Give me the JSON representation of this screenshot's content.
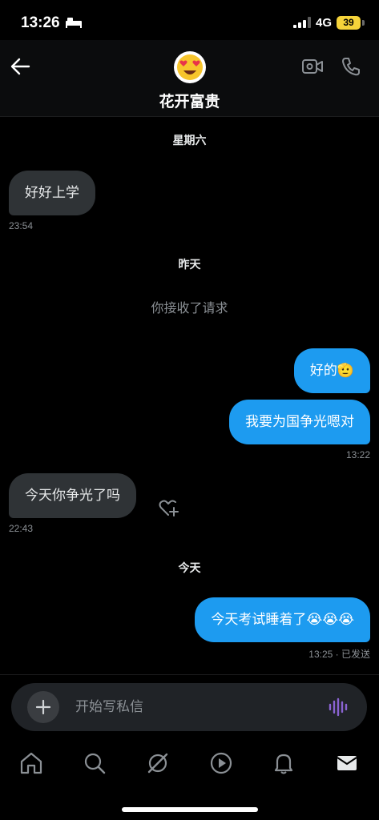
{
  "status_bar": {
    "time": "13:26",
    "network": "4G",
    "battery": "39"
  },
  "header": {
    "contact_name": "花开富贵",
    "avatar_emoji": "😍"
  },
  "thread": {
    "day_1": "星期六",
    "msg_1": {
      "text": "好好上学",
      "time": "23:54"
    },
    "day_2": "昨天",
    "system_1": "你接收了请求",
    "msg_2": {
      "text": "好的🫡"
    },
    "msg_3": {
      "text": "我要为国争光嗯对",
      "time": "13:22"
    },
    "msg_4": {
      "text": "今天你争光了吗",
      "time": "22:43"
    },
    "day_3": "今天",
    "msg_5": {
      "text": "今天考试睡着了😭😭😭",
      "time": "13:25 · 已发送"
    }
  },
  "composer": {
    "placeholder": "开始写私信"
  },
  "colors": {
    "outgoing": "#1d9bf0",
    "incoming": "#2f3336",
    "voice_icon": "#8a63d2",
    "battery": "#f5d33a"
  },
  "nav": [
    "home-icon",
    "search-icon",
    "grok-icon",
    "video-icon",
    "notifications-icon",
    "messages-icon"
  ]
}
